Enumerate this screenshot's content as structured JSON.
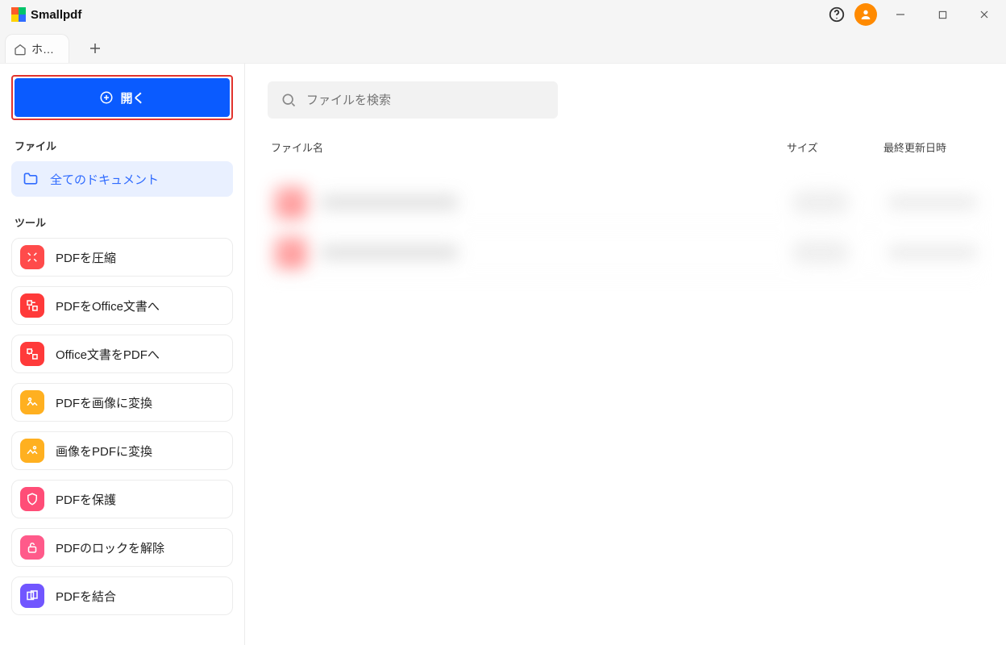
{
  "app": {
    "name": "Smallpdf"
  },
  "tabs": {
    "home_label": "ホ…"
  },
  "sidebar": {
    "open_label": "開く",
    "files_section": "ファイル",
    "all_docs": "全てのドキュメント",
    "tools_section": "ツール",
    "tools": [
      {
        "label": "PDFを圧縮"
      },
      {
        "label": "PDFをOffice文書へ"
      },
      {
        "label": "Office文書をPDFへ"
      },
      {
        "label": "PDFを画像に変換"
      },
      {
        "label": "画像をPDFに変換"
      },
      {
        "label": "PDFを保護"
      },
      {
        "label": "PDFのロックを解除"
      },
      {
        "label": "PDFを結合"
      }
    ]
  },
  "main": {
    "search_placeholder": "ファイルを検索",
    "columns": {
      "name": "ファイル名",
      "size": "サイズ",
      "date": "最終更新日時"
    }
  }
}
